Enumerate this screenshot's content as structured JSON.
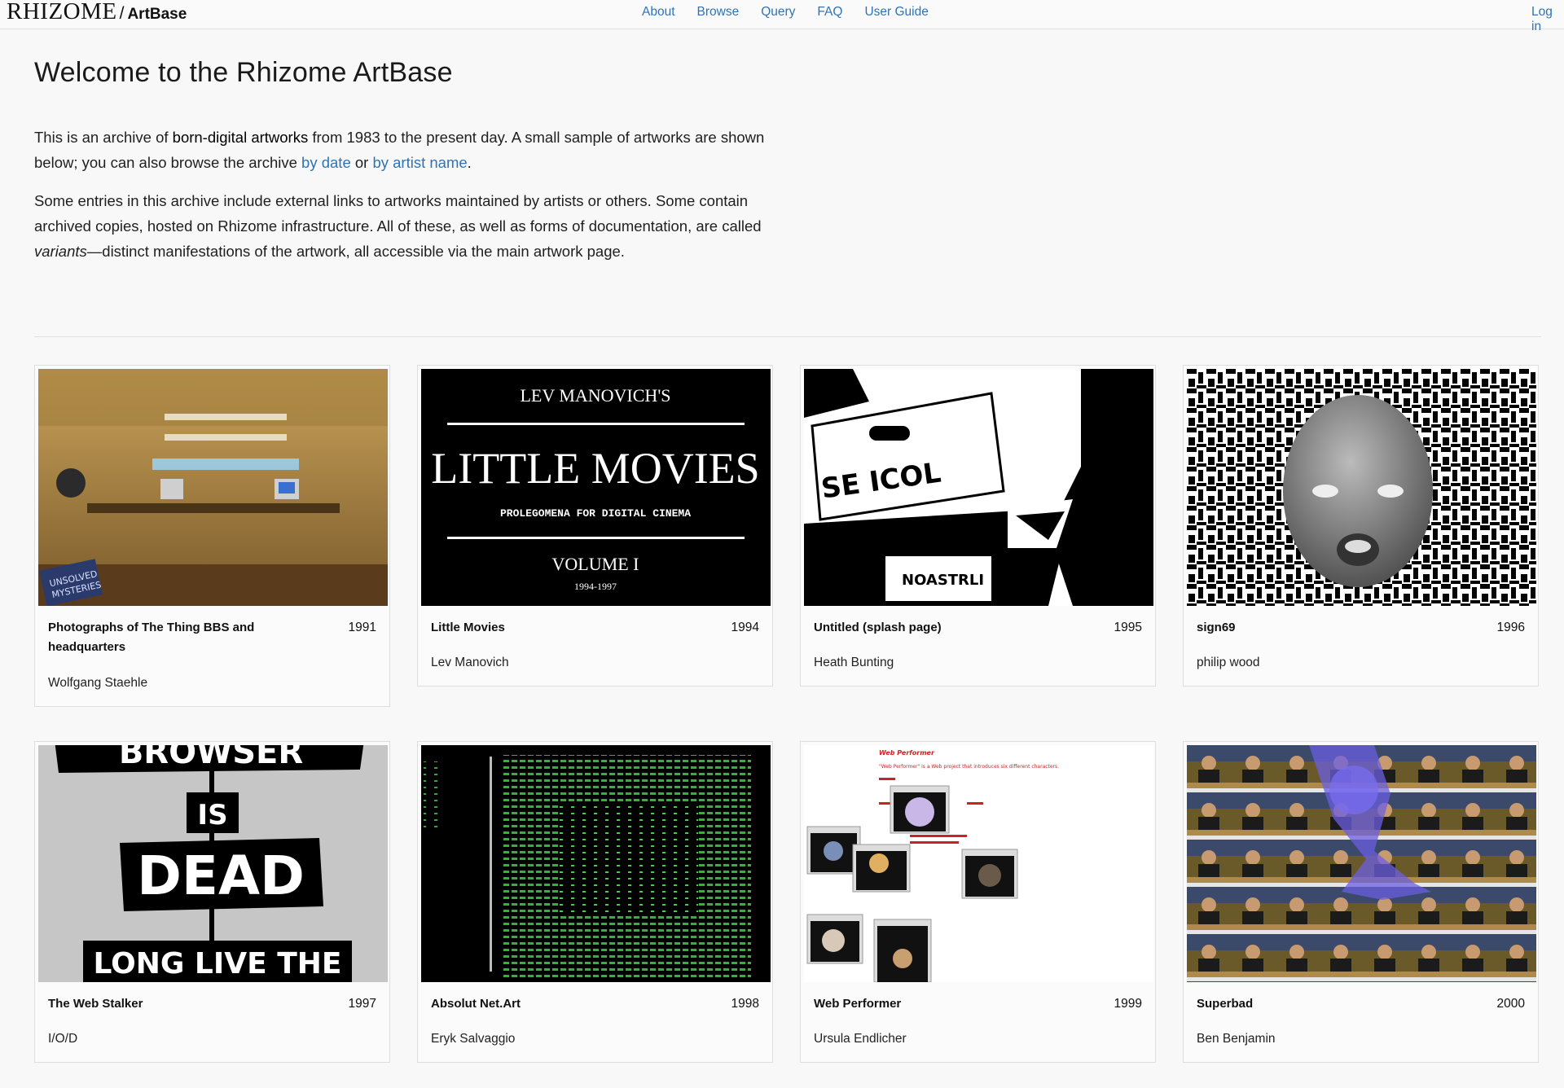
{
  "navbar": {
    "logo": "RHIZOME",
    "separator": "/",
    "site_name": "ArtBase",
    "links": [
      "About",
      "Browse",
      "Query",
      "FAQ",
      "User Guide"
    ],
    "login": "Log in"
  },
  "intro": {
    "title": "Welcome to the Rhizome ArtBase",
    "p1_a": "This is an archive of ",
    "p1_strong": "born-digital artworks",
    "p1_b": " from 1983 to the present day. A small sample of artworks are shown below; you can also browse the archive ",
    "p1_link_date": "by date",
    "p1_c": " or ",
    "p1_link_artist": "by artist name",
    "p1_d": ".",
    "p2_a": "Some entries in this archive include external links to artworks maintained by artists or others. Some contain archived copies, hosted on Rhizome infrastructure. All of these, as well as forms of documentation, are called ",
    "p2_em": "variants",
    "p2_b": "—distinct manifestations of the artwork, all accessible via the main artwork page."
  },
  "artworks": [
    {
      "title": "Photographs of The Thing BBS and headquarters",
      "year": "1991",
      "artist": "Wolfgang Staehle",
      "thumb_text": [
        "UNSOLVED",
        "MYSTERIES"
      ]
    },
    {
      "title": "Little Movies",
      "year": "1994",
      "artist": "Lev Manovich",
      "thumb_text": [
        "LEV MANOVICH'S",
        "LITTLE MOVIES",
        "PROLEGOMENA FOR DIGITAL CINEMA",
        "VOLUME I",
        "1994-1997"
      ]
    },
    {
      "title": "Untitled (splash page)",
      "year": "1995",
      "artist": "Heath Bunting",
      "thumb_text": [
        "SE ICOL",
        "NOASTRLI"
      ]
    },
    {
      "title": "sign69",
      "year": "1996",
      "artist": "philip wood",
      "thumb_text": []
    },
    {
      "title": "The Web Stalker",
      "year": "1997",
      "artist": "I/O/D",
      "thumb_text": [
        "BROWSER",
        "IS",
        "DEAD",
        "LONG LIVE THE"
      ]
    },
    {
      "title": "Absolut Net.Art",
      "year": "1998",
      "artist": "Eryk Salvaggio",
      "thumb_text": []
    },
    {
      "title": "Web Performer",
      "year": "1999",
      "artist": "Ursula Endlicher",
      "thumb_text": [
        "Web Performer",
        "\"Web Performer\" is a Web project that introduces six different characters."
      ]
    },
    {
      "title": "Superbad",
      "year": "2000",
      "artist": "Ben Benjamin",
      "thumb_text": []
    }
  ],
  "colors": {
    "link": "#2f73b5",
    "background": "#f8f8f8",
    "card_border": "#dedede",
    "web_performer_red": "#cc2222",
    "green_text": "#3fd23f"
  }
}
